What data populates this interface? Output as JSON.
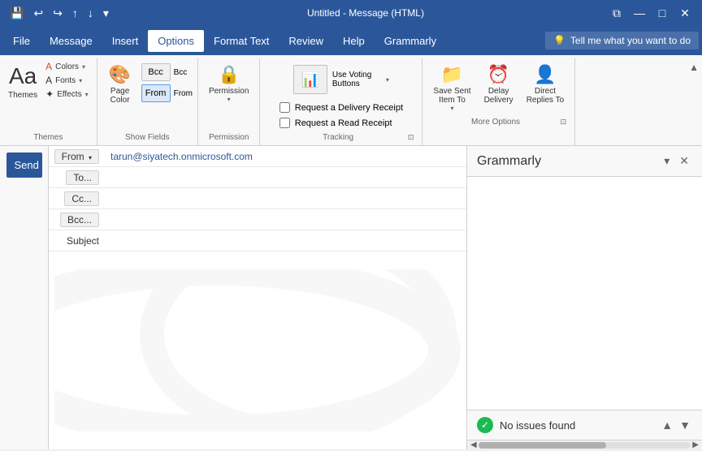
{
  "titleBar": {
    "title": "Untitled - Message (HTML)",
    "saveIcon": "💾",
    "undoIcon": "↩",
    "redoIcon": "↪",
    "upIcon": "↑",
    "downIcon": "↓",
    "moreIcon": "▾",
    "minimizeIcon": "—",
    "restoreIcon": "❐",
    "closeIcon": "✕"
  },
  "menuBar": {
    "items": [
      "File",
      "Message",
      "Insert",
      "Options",
      "Format Text",
      "Review",
      "Help",
      "Grammarly"
    ],
    "activeItem": "Options",
    "tellMe": "Tell me what you want to do"
  },
  "ribbon": {
    "groups": {
      "themes": {
        "label": "Themes",
        "themesBtnLabel": "Themes",
        "colorsBtnLabel": "Colors",
        "fontsBtnLabel": "Fonts",
        "effectsBtnLabel": "Effects"
      },
      "showFields": {
        "label": "Show Fields",
        "bccBtn": "Bcc",
        "fromBtn": "From",
        "pageColorBtn": "Page\nColor"
      },
      "permission": {
        "label": "Permission",
        "permissionBtn": "Permission"
      },
      "tracking": {
        "label": "Tracking",
        "deliveryLabel": "Request a Delivery Receipt",
        "readLabel": "Request a Read Receipt",
        "expandIcon": "⊡"
      },
      "moreOptions": {
        "label": "More Options",
        "saveSentLabel": "Save Sent\nItem To",
        "delayLabel": "Delay\nDelivery",
        "directLabel": "Direct\nReplies To",
        "expandIcon": "⊡"
      }
    }
  },
  "email": {
    "fromValue": "tarun@siyatech.onmicrosoft.com",
    "fromLabel": "From",
    "toLabel": "To...",
    "ccLabel": "Cc...",
    "bccLabel": "Bcc...",
    "subjectLabel": "Subject",
    "sendLabel": "Send",
    "toValue": "",
    "ccValue": "",
    "bccValue": "",
    "subjectValue": ""
  },
  "grammarly": {
    "title": "Grammarly",
    "noIssuesLabel": "No issues found",
    "collapseIcon": "▾",
    "closeIcon": "✕",
    "upScrollIcon": "▲",
    "downScrollIcon": "▼"
  }
}
